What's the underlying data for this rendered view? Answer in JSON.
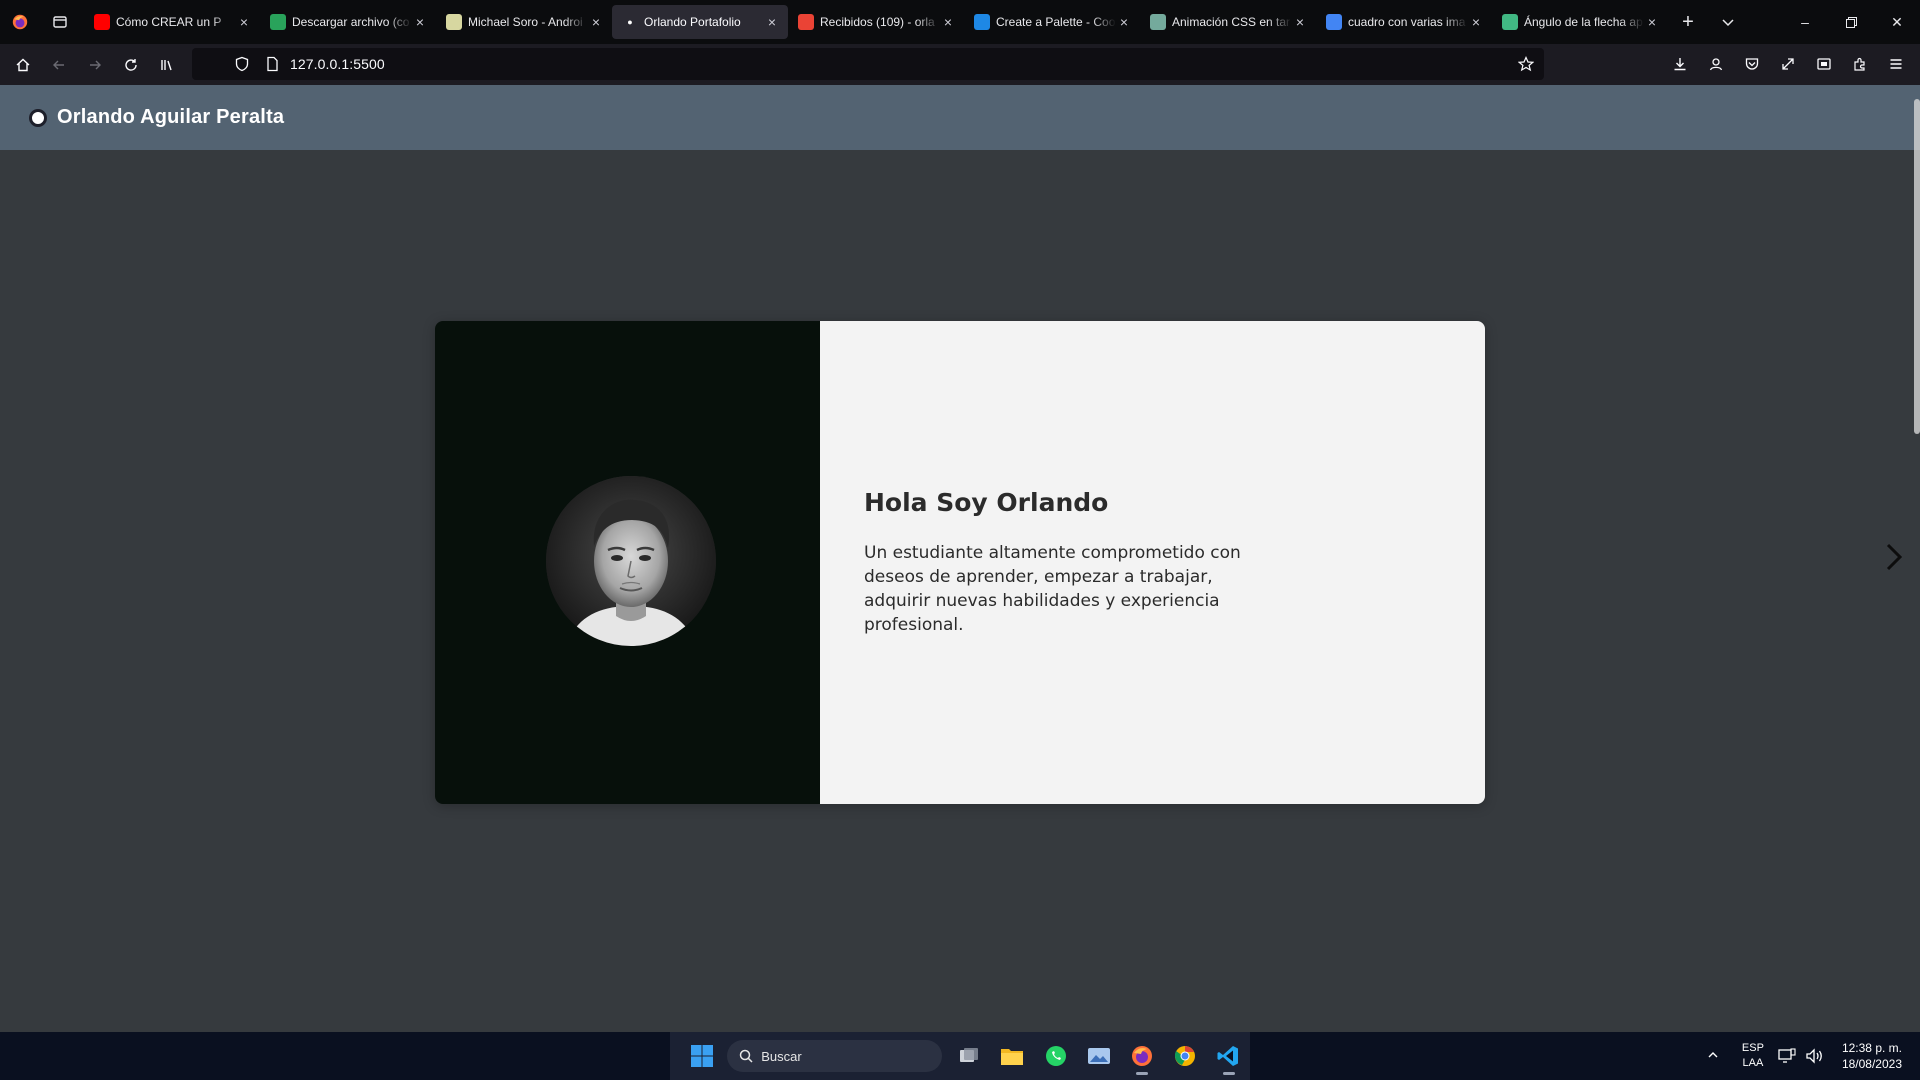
{
  "browser": {
    "tabs": [
      {
        "title": "Cómo CREAR un P",
        "favicon": "youtube-icon",
        "color": "#ff0000"
      },
      {
        "title": "Descargar archivo (co",
        "favicon": "sheet-icon",
        "color": "#29a35b"
      },
      {
        "title": "Michael Soro - Androi",
        "favicon": "ai-icon",
        "color": "#d7d7a0"
      },
      {
        "title": "Orlando Portafolio",
        "favicon": "person-icon",
        "color": "#ffffff",
        "active": true
      },
      {
        "title": "Recibidos (109) - orla",
        "favicon": "gmail-icon",
        "color": "#ea4335"
      },
      {
        "title": "Create a Palette - Coo",
        "favicon": "coolors-icon",
        "color": "#1e88e5"
      },
      {
        "title": "Animación CSS en tar",
        "favicon": "chatgpt-icon",
        "color": "#74aa9c"
      },
      {
        "title": "cuadro con varias ima",
        "favicon": "google-icon",
        "color": "#4285f4"
      },
      {
        "title": "Ángulo de la flecha ap",
        "favicon": "vue-icon",
        "color": "#41b883"
      }
    ],
    "url": "127.0.0.1:5500"
  },
  "site": {
    "brand": "Orlando Aguilar Peralta"
  },
  "hero": {
    "title": "Hola Soy Orlando",
    "text": "Un estudiante altamente comprometido con deseos de aprender, empezar a trabajar, adquirir nuevas habilidades y experiencia profesional."
  },
  "taskbar": {
    "search_placeholder": "Buscar",
    "lang_line1": "ESP",
    "lang_line2": "LAA",
    "time": "12:38 p. m.",
    "date": "18/08/2023"
  }
}
